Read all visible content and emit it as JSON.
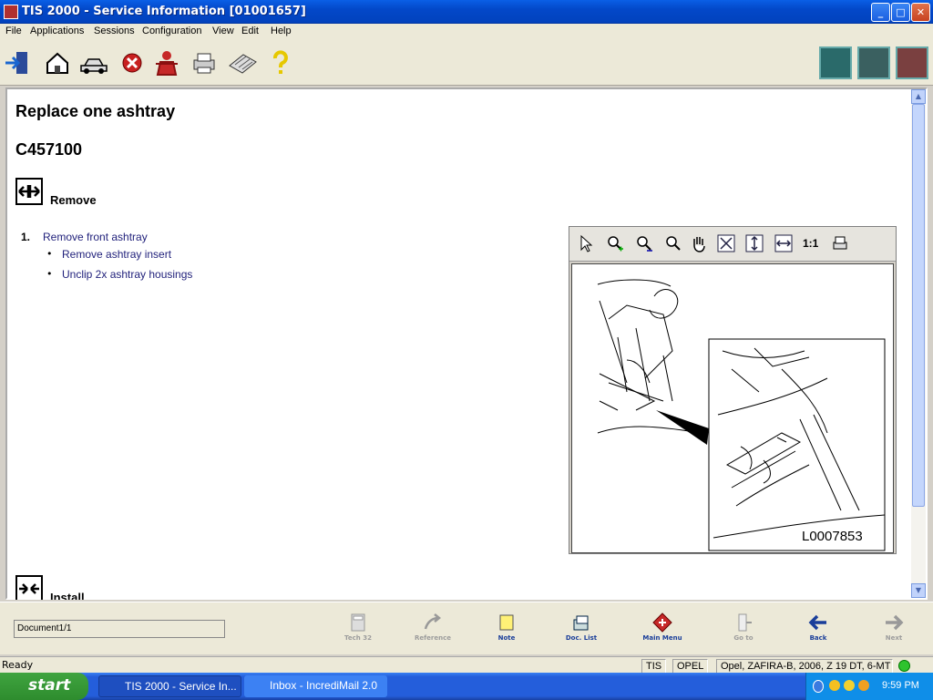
{
  "window": {
    "title": "TIS 2000 - Service Information [01001657]"
  },
  "menu": [
    "File",
    "Applications",
    "Sessions",
    "Configuration",
    "View",
    "Edit",
    "Help"
  ],
  "page": {
    "title": "Replace one ashtray",
    "code": "C457100",
    "remove_label": "Remove",
    "install_label": "Install",
    "steps": [
      {
        "num": "1.",
        "text": "Remove front ashtray",
        "bullets": [
          "Remove ashtray insert",
          "Unclip 2x ashtray housings"
        ]
      }
    ]
  },
  "viewer": {
    "tools": [
      "select-arrow",
      "zoom-in",
      "zoom-out",
      "zoom-window",
      "pan-hand",
      "fit-page",
      "fit-height",
      "fit-width",
      "1:1",
      "print"
    ],
    "one_to_one": "1:1",
    "image_id": "L0007853"
  },
  "nav": {
    "doc_position": "Document1/1",
    "buttons": [
      {
        "label": "Tech 32",
        "enabled": false
      },
      {
        "label": "Reference",
        "enabled": false
      },
      {
        "label": "Note",
        "enabled": true
      },
      {
        "label": "Doc. List",
        "enabled": true
      },
      {
        "label": "Main Menu",
        "enabled": true
      },
      {
        "label": "Go to",
        "enabled": false
      },
      {
        "label": "Back",
        "enabled": true
      },
      {
        "label": "Next",
        "enabled": false
      }
    ]
  },
  "status": {
    "ready": "Ready",
    "app": "TIS",
    "brand": "OPEL",
    "vehicle": "Opel, ZAFIRA-B, 2006, Z 19 DT, 6-MT"
  },
  "taskbar": {
    "start": "start",
    "items": [
      "TIS 2000 - Service In...",
      "Inbox - IncrediMail 2.0"
    ],
    "clock": "9:59 PM"
  }
}
